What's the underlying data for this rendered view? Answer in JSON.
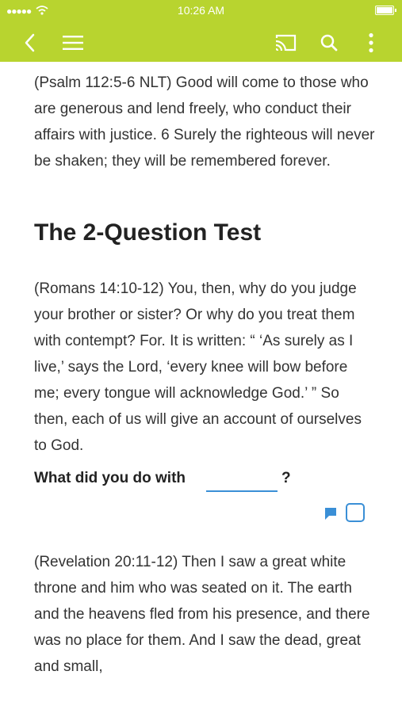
{
  "status_bar": {
    "signal": "●●●●●",
    "time": "10:26 AM"
  },
  "app_bar": {
    "icons": [
      "back-icon",
      "menu-icon",
      "cast-icon",
      "search-icon",
      "more-vertical-icon"
    ],
    "accent_color": "#b8d42f"
  },
  "content": {
    "psalm_paragraph": "(Psalm 112:5-6 NLT) Good will come to those who are generous and lend freely, who conduct their affairs with justice. 6 Surely the righteous will never be shaken; they will be remembered forever.",
    "section_heading": "The 2-Question Test",
    "romans_paragraph": "(Romans 14:10-12) You, then, why do you judge your brother or sister? Or why do you treat them with contempt? For. It is written: “ ‘As surely as I live,’ says the Lord, ‘every knee will bow before me; every tongue will acknowledge God.’ ” So then, each of us will give an account of ourselves to God.",
    "question": {
      "label": "What did you do with",
      "answer_value": "",
      "suffix": "?"
    },
    "revelation_paragraph": "(Revelation 20:11-12) Then I saw a great white throne and him who was seated on it. The earth and the heavens fled from his presence, and there was no place for them. And I saw the dead, great and small,"
  }
}
